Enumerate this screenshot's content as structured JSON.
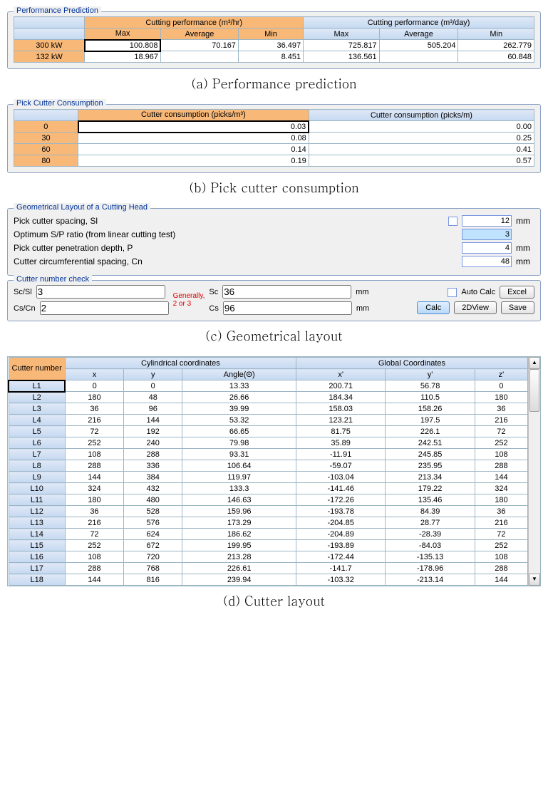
{
  "a": {
    "legend": "Performance Prediction",
    "groupA": "Cutting performance (m³/hr)",
    "groupB": "Cutting performance (m³/day)",
    "cols": [
      "Max",
      "Average",
      "Min",
      "Max",
      "Average",
      "Min"
    ],
    "rows": [
      {
        "head": "300 kW",
        "vals": [
          "100.808",
          "70.167",
          "36.497",
          "725.817",
          "505.204",
          "262.779"
        ]
      },
      {
        "head": "132 kW",
        "vals": [
          "18.967",
          "",
          "8.451",
          "136.561",
          "",
          "60.848"
        ]
      }
    ],
    "caption": "(a) Performance prediction"
  },
  "b": {
    "legend": "Pick Cutter Consumption",
    "col1": "Cutter consumption (picks/m³)",
    "col2": "Cutter consumption (picks/m)",
    "rows": [
      {
        "head": "0",
        "v1": "0.03",
        "v2": "0.00"
      },
      {
        "head": "30",
        "v1": "0.08",
        "v2": "0.25"
      },
      {
        "head": "60",
        "v1": "0.14",
        "v2": "0.41"
      },
      {
        "head": "80",
        "v1": "0.19",
        "v2": "0.57"
      }
    ],
    "caption": "(b) Pick cutter consumption"
  },
  "c": {
    "legend1": "Geometrical Layout of a Cutting Head",
    "l1": "Pick cutter spacing, Sl",
    "v1": "12",
    "u1": "mm",
    "l2": "Optimum S/P ratio (from linear cutting test)",
    "v2": "3",
    "l3": "Pick cutter penetration depth, P",
    "v3": "4",
    "u3": "mm",
    "l4": "Cutter circumferential spacing, Cn",
    "v4": "48",
    "u4": "mm",
    "legend2": "Cutter number check",
    "sc_sl_label": "Sc/Sl",
    "sc_sl_val": "3",
    "cs_cn_label": "Cs/Cn",
    "cs_cn_val": "2",
    "note": "Generally,\n2 or 3",
    "sc_label": "Sc",
    "sc_val": "36",
    "mm": "mm",
    "cs_label": "Cs",
    "cs_val": "96",
    "auto_label": "Auto Calc",
    "btn_excel": "Excel",
    "btn_calc": "Calc",
    "btn_2d": "2DView",
    "btn_save": "Save",
    "caption": "(c) Geometrical layout"
  },
  "d": {
    "hdrTop": "Cutter number",
    "grpA": "Cylindrical coordinates",
    "grpB": "Global Coordinates",
    "colsA": [
      "x",
      "y",
      "Angle(Θ)"
    ],
    "colsB": [
      "x'",
      "y'",
      "z'"
    ],
    "rows": [
      {
        "n": "L1",
        "c": [
          "0",
          "0",
          "13.33",
          "200.71",
          "56.78",
          "0"
        ]
      },
      {
        "n": "L2",
        "c": [
          "180",
          "48",
          "26.66",
          "184.34",
          "110.5",
          "180"
        ]
      },
      {
        "n": "L3",
        "c": [
          "36",
          "96",
          "39.99",
          "158.03",
          "158.26",
          "36"
        ]
      },
      {
        "n": "L4",
        "c": [
          "216",
          "144",
          "53.32",
          "123.21",
          "197.5",
          "216"
        ]
      },
      {
        "n": "L5",
        "c": [
          "72",
          "192",
          "66.65",
          "81.75",
          "226.1",
          "72"
        ]
      },
      {
        "n": "L6",
        "c": [
          "252",
          "240",
          "79.98",
          "35.89",
          "242.51",
          "252"
        ]
      },
      {
        "n": "L7",
        "c": [
          "108",
          "288",
          "93.31",
          "-11.91",
          "245.85",
          "108"
        ]
      },
      {
        "n": "L8",
        "c": [
          "288",
          "336",
          "106.64",
          "-59.07",
          "235.95",
          "288"
        ]
      },
      {
        "n": "L9",
        "c": [
          "144",
          "384",
          "119.97",
          "-103.04",
          "213.34",
          "144"
        ]
      },
      {
        "n": "L10",
        "c": [
          "324",
          "432",
          "133.3",
          "-141.46",
          "179.22",
          "324"
        ]
      },
      {
        "n": "L11",
        "c": [
          "180",
          "480",
          "146.63",
          "-172.26",
          "135.46",
          "180"
        ]
      },
      {
        "n": "L12",
        "c": [
          "36",
          "528",
          "159.96",
          "-193.78",
          "84.39",
          "36"
        ]
      },
      {
        "n": "L13",
        "c": [
          "216",
          "576",
          "173.29",
          "-204.85",
          "28.77",
          "216"
        ]
      },
      {
        "n": "L14",
        "c": [
          "72",
          "624",
          "186.62",
          "-204.89",
          "-28.39",
          "72"
        ]
      },
      {
        "n": "L15",
        "c": [
          "252",
          "672",
          "199.95",
          "-193.89",
          "-84.03",
          "252"
        ]
      },
      {
        "n": "L16",
        "c": [
          "108",
          "720",
          "213.28",
          "-172.44",
          "-135.13",
          "108"
        ]
      },
      {
        "n": "L17",
        "c": [
          "288",
          "768",
          "226.61",
          "-141.7",
          "-178.96",
          "288"
        ]
      },
      {
        "n": "L18",
        "c": [
          "144",
          "816",
          "239.94",
          "-103.32",
          "-213.14",
          "144"
        ]
      }
    ],
    "caption": "(d) Cutter layout"
  }
}
